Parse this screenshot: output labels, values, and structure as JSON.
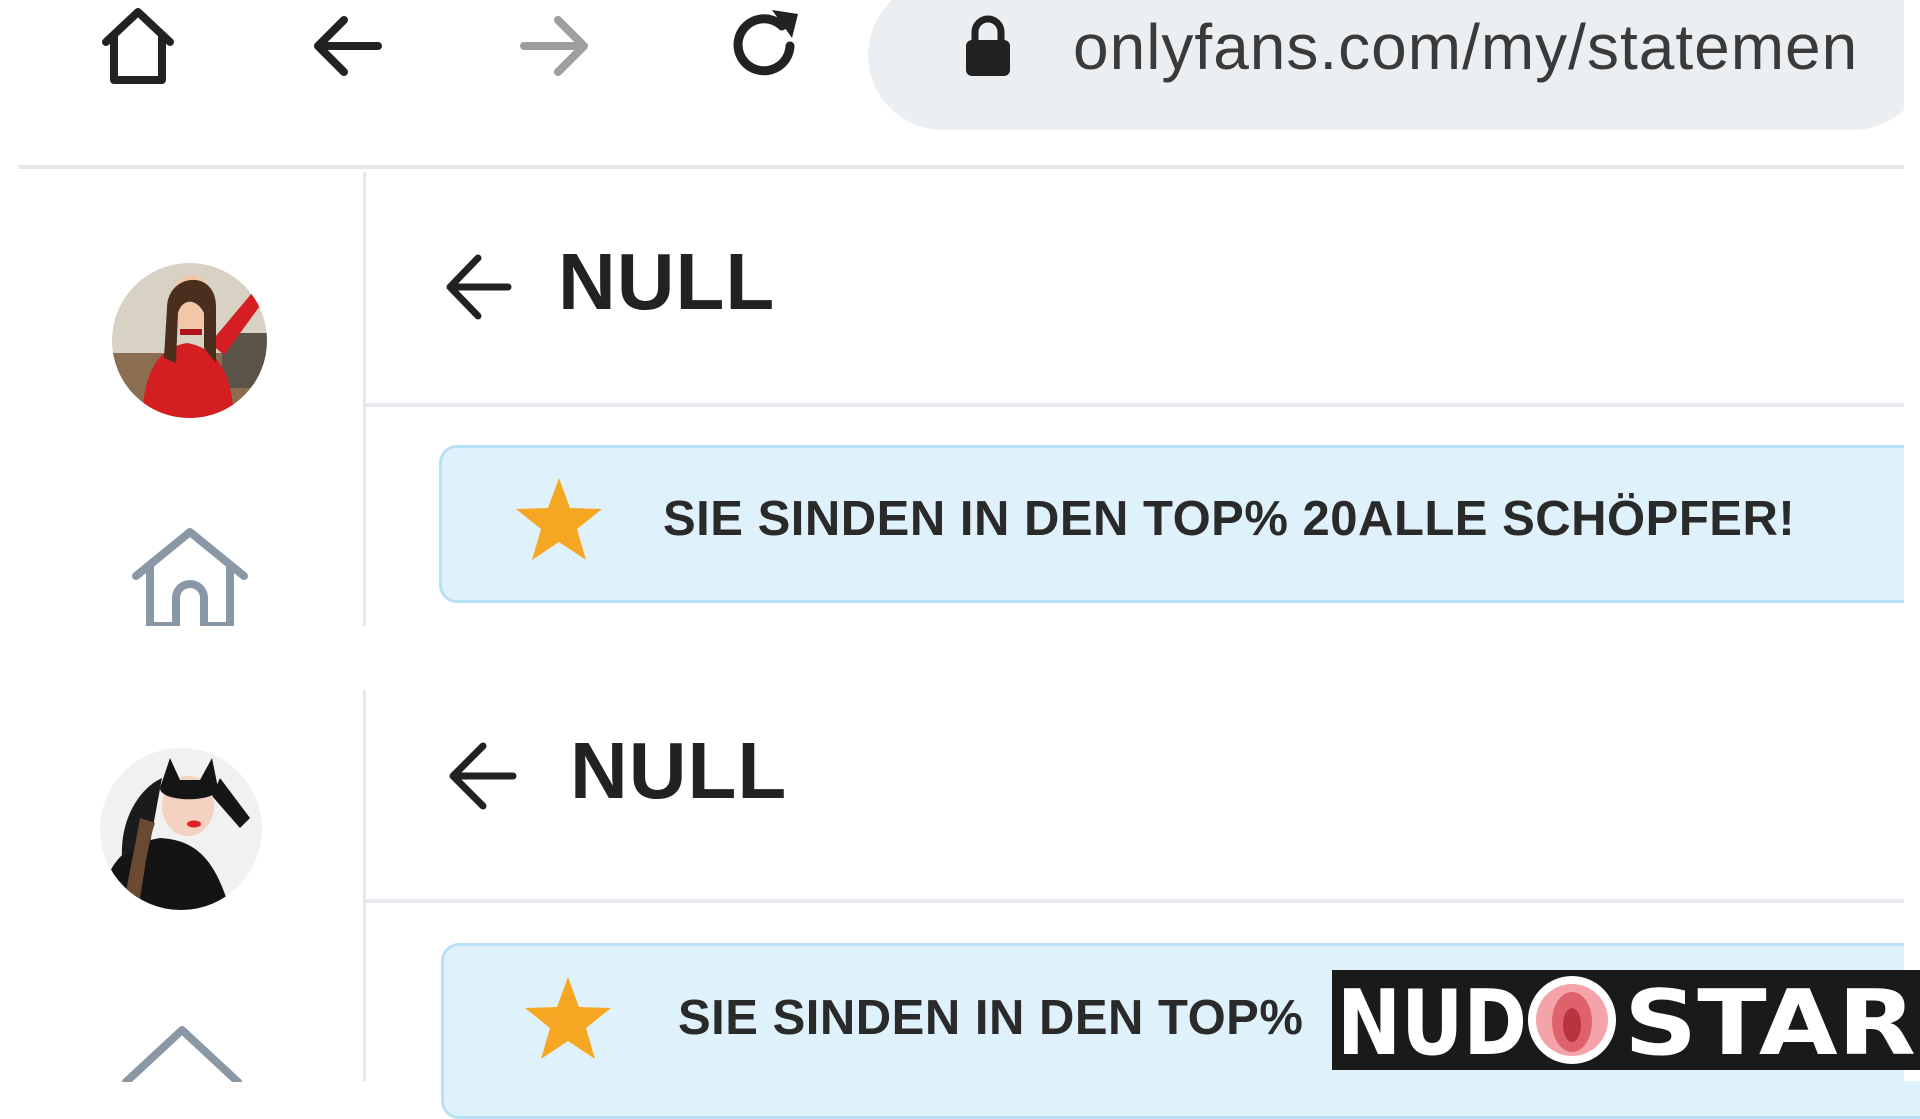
{
  "browser": {
    "url": "onlyfans.com/my/statemen",
    "icons": [
      "home-icon",
      "back-icon",
      "forward-icon",
      "reload-icon",
      "lock-icon"
    ]
  },
  "panels": [
    {
      "title": "NULL",
      "banner": "SIE SINDEN IN DEN TOP% 20ALLE SCHÖPFER!"
    },
    {
      "title": "NULL",
      "banner": "SIE SINDEN IN DEN TOP%"
    }
  ],
  "watermark": {
    "text": "NUDOSTAR"
  },
  "colors": {
    "banner_bg": "#dff2fc",
    "banner_border": "#b9e1f6",
    "star": "#f5a623",
    "url_pill": "#eceff1"
  }
}
